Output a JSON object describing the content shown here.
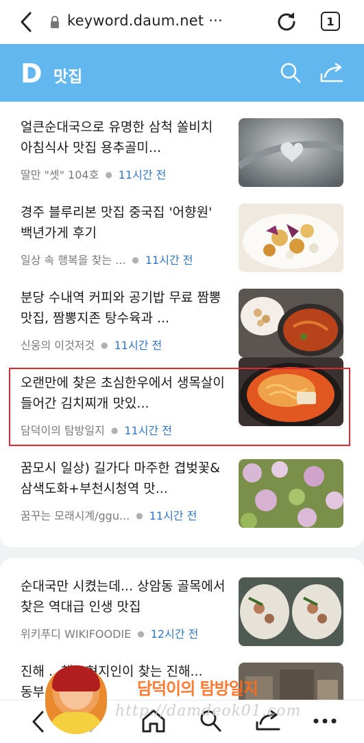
{
  "browser": {
    "url": "keyword.daum.net ···",
    "tab_count": "1"
  },
  "header": {
    "logo": "D",
    "title": "맛집"
  },
  "articles": [
    {
      "title": "얼큰순대국으로 유명한 삼척 쏠비치 아침식사 맛집 용추골미...",
      "source": "딸만 \"셋\" 104호",
      "time": "11시간 전"
    },
    {
      "title": "경주 블루리본 맛집 중국집 '어향원' 백년가게 후기",
      "source": "일상 속 행복을 찾는 ...",
      "time": "11시간 전"
    },
    {
      "title": "분당 수내역 커피와 공기밥 무료 짬뽕 맛집, 짬뽕지존 탕수육과 ...",
      "source": "신웅의 이것저것",
      "time": "11시간 전"
    },
    {
      "title": "오랜만에 찾은 초심한우에서 생목살이 들어간 김치찌개 맛있...",
      "source": "담덕이의 탐방일지",
      "time": "11시간 전"
    },
    {
      "title": "꿈모시 일상) 길가다 마주한 겹벚꽃&삼색도화+부천시청역 맛...",
      "source": "꿈꾸는 모래시계/ggu...",
      "time": "11시간 전"
    },
    {
      "title": "순대국만 시켰는데... 상암동 골목에서 찾은 역대급 인생 맛집",
      "source": "위키푸디 WIKIFOODIE",
      "time": "12시간 전"
    },
    {
      "title": "진해 ...행 - 현지인이 찾는 진해...동부...",
      "source": "",
      "time": ""
    }
  ],
  "watermark": {
    "title": "담덕이의 탐방일지",
    "url": "http://damdeok01.com"
  },
  "icons": [
    "back-icon",
    "lock-icon",
    "reload-icon",
    "tabs-icon",
    "search-icon",
    "share-icon",
    "home-icon",
    "more-icon"
  ],
  "colors": {
    "header_bg": "#62b7ee",
    "time_text": "#2f74c9",
    "highlight": "#e0282e"
  }
}
